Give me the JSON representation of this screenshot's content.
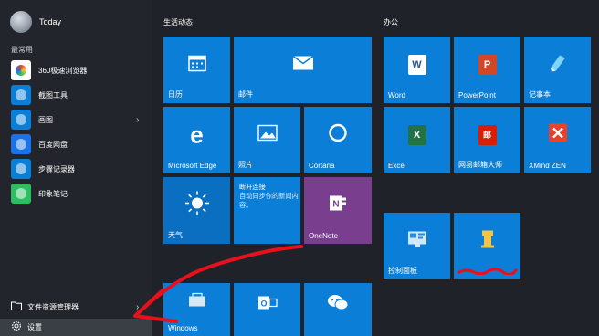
{
  "user": {
    "name": "Today"
  },
  "left": {
    "section_title": "最常用",
    "apps": [
      {
        "label": "360极速浏览器",
        "icon": "360-browser-icon",
        "color": "#ffffff",
        "arrow": false
      },
      {
        "label": "截图工具",
        "icon": "snipping-tool-icon",
        "color": "#0b7fd8",
        "arrow": false
      },
      {
        "label": "画图",
        "icon": "paint-icon",
        "color": "#0b7fd8",
        "arrow": true
      },
      {
        "label": "百度网盘",
        "icon": "baidu-netdisk-icon",
        "color": "#1a73e8",
        "arrow": false
      },
      {
        "label": "步骤记录器",
        "icon": "steps-recorder-icon",
        "color": "#0b7fd8",
        "arrow": false
      },
      {
        "label": "印象笔记",
        "icon": "evernote-icon",
        "color": "#2dbe60",
        "arrow": false
      }
    ],
    "bottom": {
      "file_explorer": "文件资源管理器",
      "settings": "设置"
    }
  },
  "groups": {
    "life": {
      "title": "生活动态"
    },
    "office": {
      "title": "办公"
    }
  },
  "tiles": {
    "calendar": "日历",
    "mail": "邮件",
    "edge": "Microsoft Edge",
    "photos": "照片",
    "cortana": "Cortana",
    "weather": "天气",
    "news_title": "断开连接",
    "news_body": "自动同步你的新闻内容。",
    "onenote": "OneNote",
    "windows": "Windows",
    "word": "Word",
    "powerpoint": "PowerPoint",
    "notepad": "记事本",
    "excel": "Excel",
    "netease": "网易邮箱大师",
    "xmind": "XMind ZEN",
    "control_panel": "控制面板"
  },
  "colors": {
    "tile_blue": "#0b7fd8",
    "tile_purple": "#7a3e8f",
    "background": "#1f2329",
    "annotation_red": "#e8101a"
  }
}
